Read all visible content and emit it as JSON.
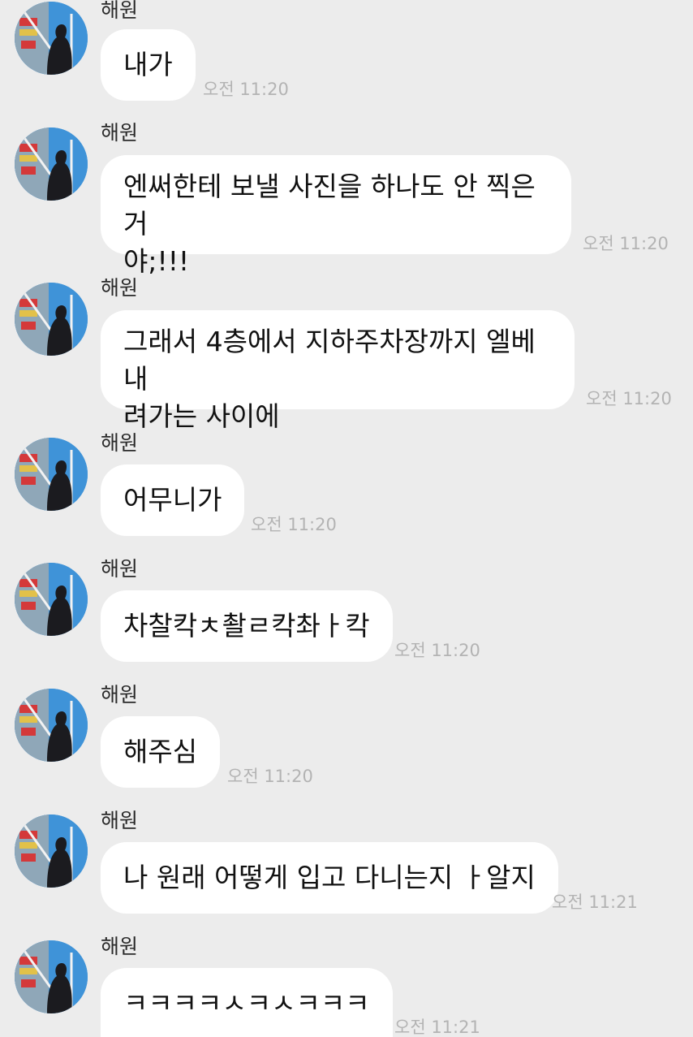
{
  "messages": [
    {
      "sender": "해원",
      "text": "내가",
      "time": "오전 11:20"
    },
    {
      "sender": "해원",
      "text": "엔써한테 보낼 사진을 하나도 안 찍은 거\n야;!!!",
      "time": "오전 11:20"
    },
    {
      "sender": "해원",
      "text": "그래서 4층에서 지하주차장까지 엘베 내\n려가는 사이에",
      "time": "오전 11:20"
    },
    {
      "sender": "해원",
      "text": "어무니가",
      "time": "오전 11:20"
    },
    {
      "sender": "해원",
      "text": "차찰칵ㅊ촬ㄹ칵촤ㅏ칵",
      "time": "오전 11:20"
    },
    {
      "sender": "해원",
      "text": "해주심",
      "time": "오전 11:20"
    },
    {
      "sender": "해원",
      "text": "나 원래 어떻게 입고 다니는지 ㅏ알지",
      "time": "오전 11:21"
    },
    {
      "sender": "해원",
      "text": "ㅋㅋㅋㅋㅅㅋㅅㅋㅋㅋ",
      "time": "오전 11:21"
    }
  ],
  "colors": {
    "background": "#ececec",
    "bubble": "#ffffff",
    "timestamp": "#b3b3b3",
    "sender": "#2a2a2a"
  }
}
